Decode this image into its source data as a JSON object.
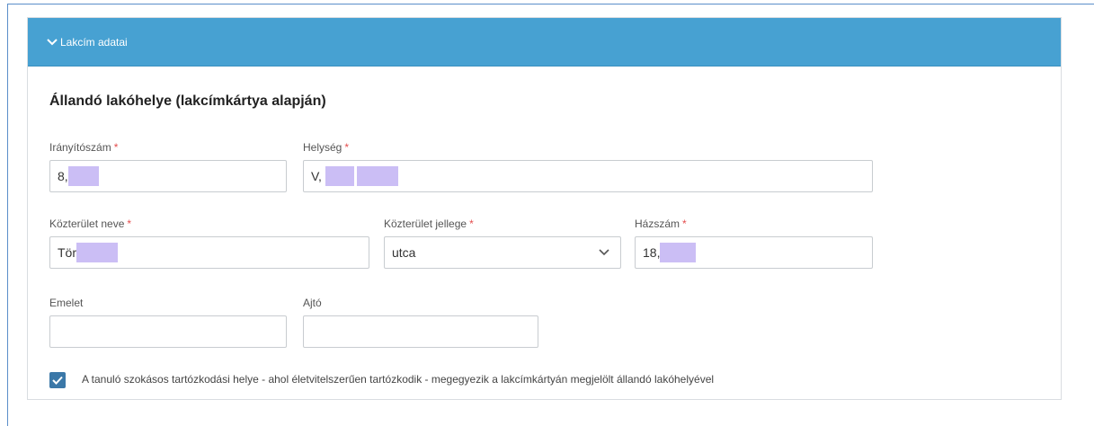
{
  "section": {
    "header": "Lakcím adatai",
    "title": "Állandó lakóhelye (lakcímkártya alapján)"
  },
  "required_mark": "*",
  "fields": {
    "zip": {
      "label": "Irányítószám",
      "value": "8,"
    },
    "city": {
      "label": "Helység",
      "value": "V,"
    },
    "street_name": {
      "label": "Közterület neve",
      "value": "Tör"
    },
    "street_type": {
      "label": "Közterület jellege",
      "value": "utca"
    },
    "house_number": {
      "label": "Házszám",
      "value": "18,"
    },
    "floor": {
      "label": "Emelet",
      "value": ""
    },
    "door": {
      "label": "Ajtó",
      "value": ""
    }
  },
  "checkbox": {
    "checked": true,
    "label": "A tanuló szokásos tartózkodási helye - ahol életvitelszerűen tartózkodik - megegyezik a lakcímkártyán megjelölt állandó lakóhelyével"
  },
  "colors": {
    "header_bg": "#47a1d2",
    "checkbox_bg": "#3b78a8",
    "required": "#e44d4d",
    "redaction": "#cbbef5"
  }
}
